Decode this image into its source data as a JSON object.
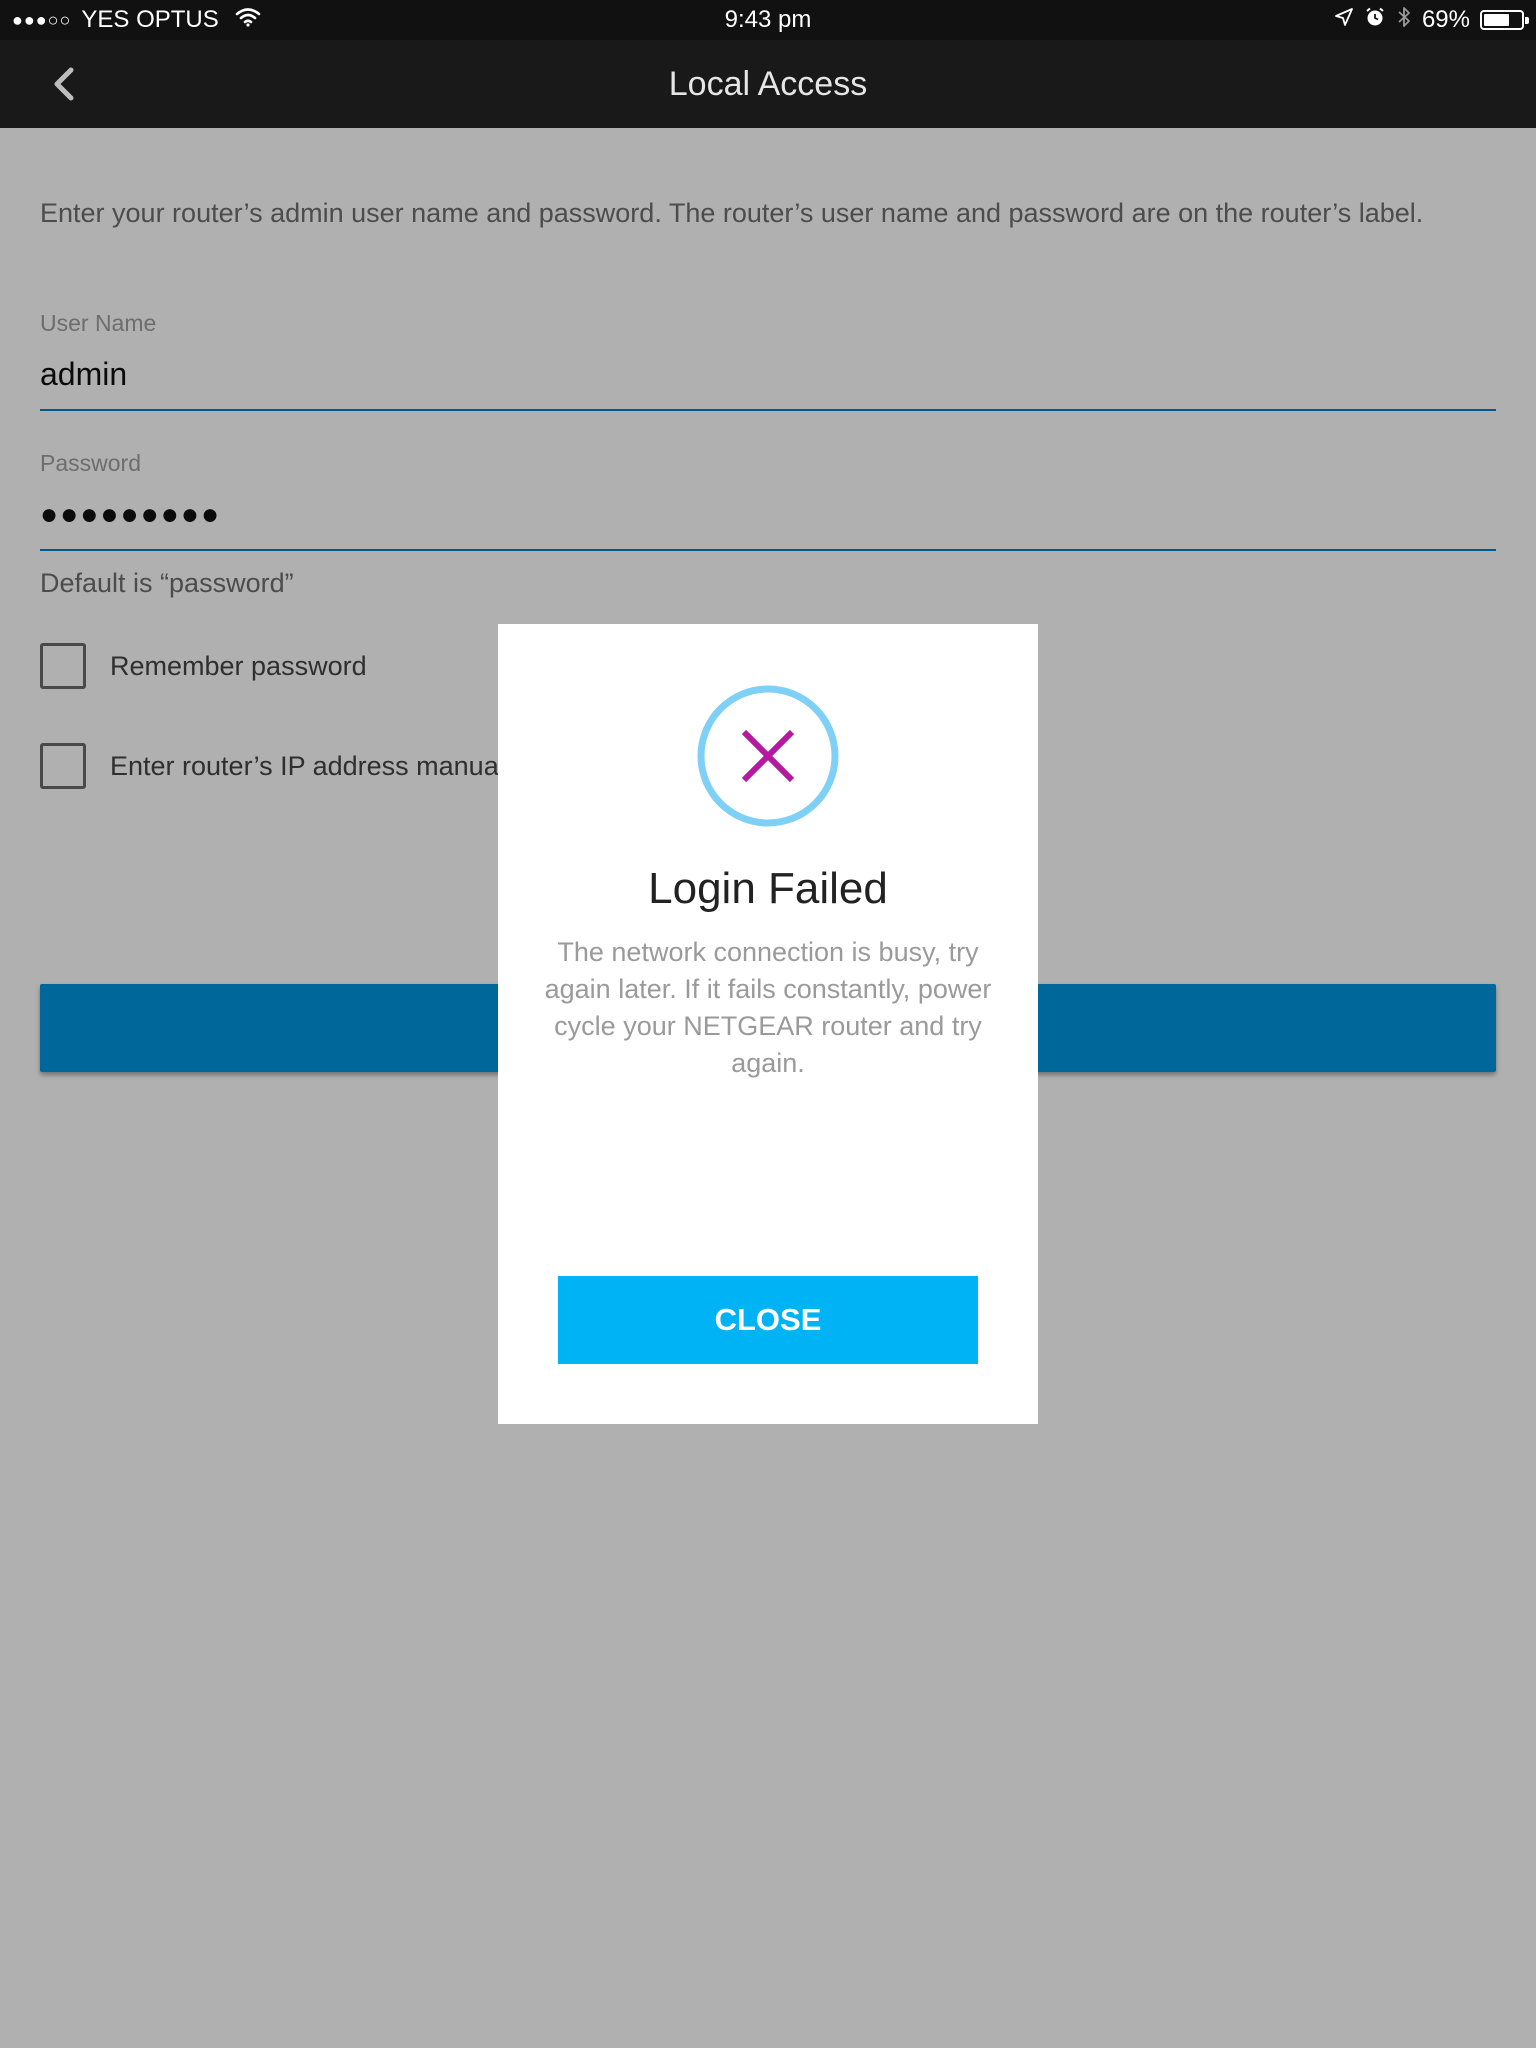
{
  "status_bar": {
    "signal": "●●●○○",
    "carrier": "YES OPTUS",
    "time": "9:43 pm",
    "battery_percent": "69%",
    "battery_level": 0.69,
    "icons": [
      "wifi-icon",
      "location-arrow-icon",
      "alarm-icon",
      "bluetooth-icon",
      "battery-icon"
    ]
  },
  "nav": {
    "title": "Local Access",
    "back_icon": "chevron-left-icon"
  },
  "form": {
    "instructions": "Enter your router’s admin user name and password. The router’s user name and password are on the router’s label.",
    "username_label": "User Name",
    "username_value": "admin",
    "password_label": "Password",
    "password_value": "●●●●●●●●●",
    "password_hint": "Default is “password”",
    "remember_label": "Remember password",
    "remember_checked": false,
    "manual_ip_label": "Enter router’s IP address manually",
    "manual_ip_checked": false
  },
  "dialog": {
    "icon": "error-x-icon",
    "title": "Login Failed",
    "message": "The network connection is busy, try again later. If it fails constantly, power cycle your NETGEAR router and try again.",
    "close_label": "CLOSE"
  },
  "colors": {
    "accent_blue": "#0096e0",
    "dialog_button": "#00b3f5",
    "icon_ring": "#7fd0f7",
    "icon_x": "#b5199f",
    "field_underline": "#0080c8"
  }
}
